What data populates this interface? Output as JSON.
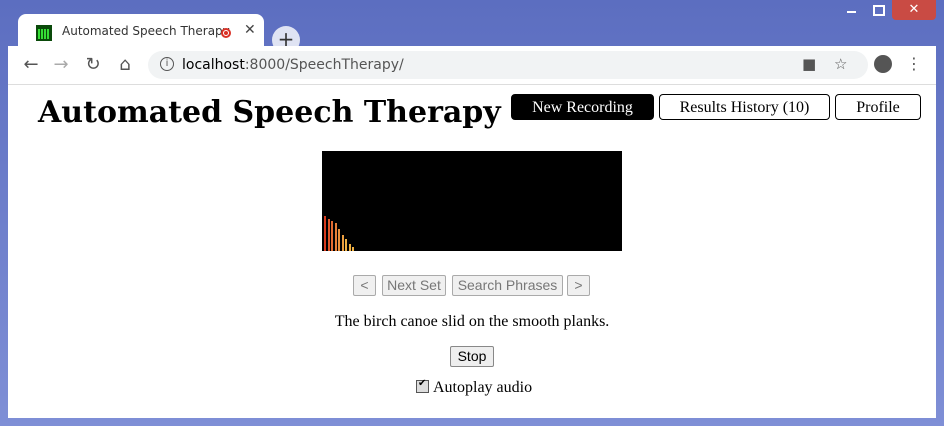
{
  "browser": {
    "tab": {
      "title": "Automated Speech Therapy",
      "favicon": "sound-bars-icon",
      "recording_indicator": "recording-dot-icon",
      "close_label": "✕"
    },
    "new_tab_label": "+",
    "window_controls": {
      "close_label": "✕"
    },
    "address": {
      "host": "localhost",
      "path": ":8000/SpeechTherapy/"
    }
  },
  "app": {
    "title": "Automated Speech Therapy",
    "nav": [
      {
        "label": "New Recording",
        "active": true
      },
      {
        "label": "Results History (10)",
        "active": false
      },
      {
        "label": "Profile",
        "active": false
      }
    ]
  },
  "visualizer": {
    "bar_colors": [
      "#d83a1f",
      "#e0562a",
      "#e36b32",
      "#e57e38",
      "#e88f3c",
      "#eb9e40",
      "#efb042"
    ],
    "bar_levels": [
      0.35,
      0.32,
      0.3,
      0.28,
      0.22,
      0.16,
      0.12,
      0.07,
      0.04
    ]
  },
  "controls": {
    "prev_label": "<",
    "next_set_label": "Next Set",
    "search_label": "Search Phrases",
    "next_label": ">"
  },
  "phrase": "The birch canoe slid on the smooth planks.",
  "stop_label": "Stop",
  "autoplay": {
    "label": "Autoplay audio",
    "checked": true
  },
  "colors": {
    "frame": "#6f7fc6",
    "active_nav": "#000000"
  }
}
